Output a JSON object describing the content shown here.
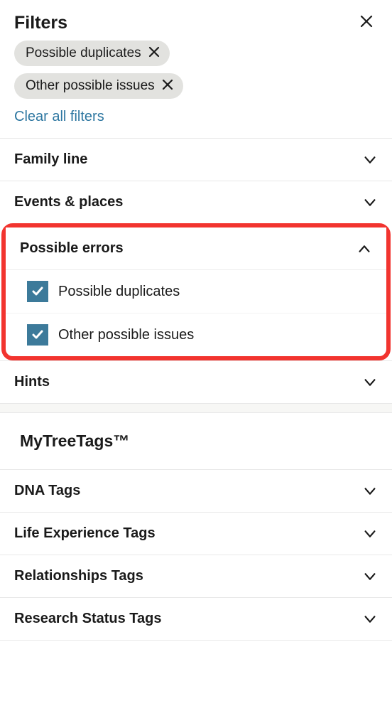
{
  "header": {
    "title": "Filters"
  },
  "chips": [
    {
      "label": "Possible duplicates"
    },
    {
      "label": "Other possible issues"
    }
  ],
  "clear_label": "Clear all filters",
  "sections": {
    "family_line": "Family line",
    "events_places": "Events & places",
    "possible_errors": "Possible errors",
    "hints": "Hints"
  },
  "error_options": [
    {
      "label": "Possible duplicates",
      "checked": true
    },
    {
      "label": "Other possible issues",
      "checked": true
    }
  ],
  "tags_header": "MyTreeTags™",
  "tag_sections": {
    "dna": "DNA Tags",
    "life": "Life Experience Tags",
    "relationships": "Relationships Tags",
    "research": "Research Status Tags"
  }
}
